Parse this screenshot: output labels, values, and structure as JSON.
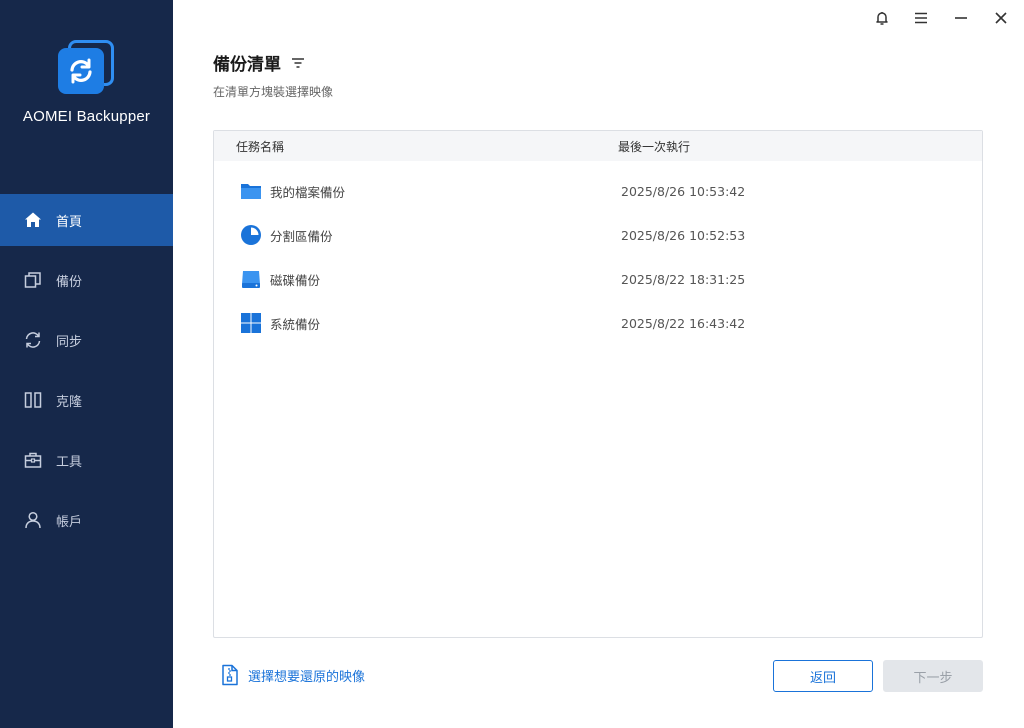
{
  "app": {
    "name": "AOMEI Backupper"
  },
  "sidebar": {
    "items": [
      {
        "label": "首頁",
        "icon": "home-icon",
        "active": true
      },
      {
        "label": "備份",
        "icon": "backup-icon"
      },
      {
        "label": "同步",
        "icon": "sync-icon"
      },
      {
        "label": "克隆",
        "icon": "clone-icon"
      },
      {
        "label": "工具",
        "icon": "tools-icon"
      },
      {
        "label": "帳戶",
        "icon": "account-icon"
      }
    ]
  },
  "titlebar": {
    "icons": [
      "bell-icon",
      "menu-icon",
      "minimize-icon",
      "close-icon"
    ]
  },
  "header": {
    "title": "備份清單",
    "subtitle": "在清單方塊裝選擇映像"
  },
  "table": {
    "columns": [
      "任務名稱",
      "最後一次執行"
    ],
    "rows": [
      {
        "name": "我的檔案備份",
        "time": "2025/8/26 10:53:42",
        "icon": "folder-icon"
      },
      {
        "name": "分割區備份",
        "time": "2025/8/26 10:52:53",
        "icon": "partition-icon"
      },
      {
        "name": "磁碟備份",
        "time": "2025/8/22 18:31:25",
        "icon": "disk-icon"
      },
      {
        "name": "系統備份",
        "time": "2025/8/22 16:43:42",
        "icon": "windows-icon"
      }
    ]
  },
  "footer": {
    "restore_link": "選擇想要還原的映像",
    "back_label": "返回",
    "next_label": "下一步"
  },
  "colors": {
    "sidebar": "#16284a",
    "active": "#1e5aa8",
    "accent": "#1a73d9"
  }
}
